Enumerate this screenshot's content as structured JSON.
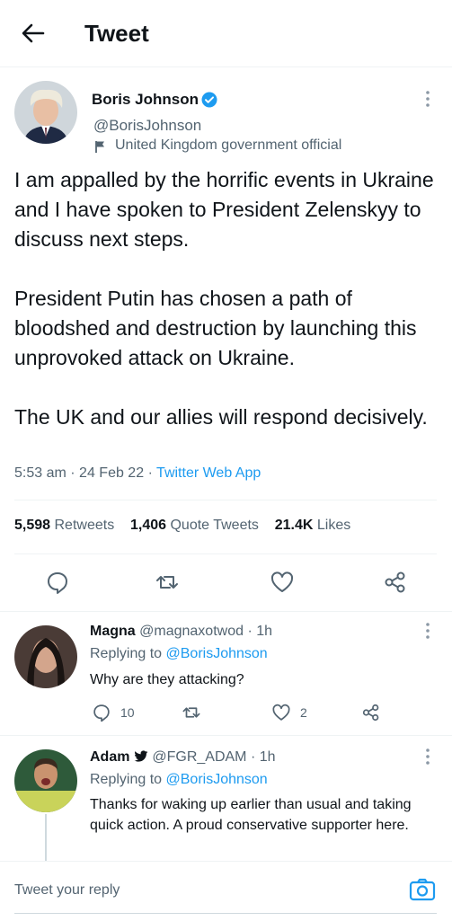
{
  "header": {
    "title": "Tweet"
  },
  "main_tweet": {
    "name": "Boris Johnson",
    "handle": "@BorisJohnson",
    "label": "United Kingdom government official",
    "text": "I am appalled by the horrific events in Ukraine and I have spoken to President Zelenskyy to discuss next steps.\n\nPresident Putin has chosen a path of bloodshed and destruction by launching this unprovoked attack on Ukraine.\n\nThe UK and our allies will respond decisively.",
    "time": "5:53 am",
    "date": "24 Feb 22",
    "source": "Twitter Web App",
    "retweets_count": "5,598",
    "retweets_label": "Retweets",
    "quotes_count": "1,406",
    "quotes_label": "Quote Tweets",
    "likes_count": "21.4K",
    "likes_label": "Likes"
  },
  "replies": [
    {
      "name": "Magna",
      "handle": "@magnaxotwod",
      "age": "1h",
      "replying_prefix": "Replying to",
      "replying_to": "@BorisJohnson",
      "text": "Why are they attacking?",
      "reply_count": "10",
      "like_count": "2"
    },
    {
      "name": "Adam",
      "handle": "@FGR_ADAM",
      "age": "1h",
      "replying_prefix": "Replying to",
      "replying_to": "@BorisJohnson",
      "text": "Thanks for waking up earlier than usual and taking quick action. A proud conservative supporter here."
    }
  ],
  "composer": {
    "placeholder": "Tweet your reply"
  },
  "colors": {
    "accent": "#1d9bf0",
    "text": "#0f1419",
    "muted": "#536471",
    "divider": "#eff3f4"
  },
  "icons": [
    "back-arrow-icon",
    "verified-badge-icon",
    "flag-icon",
    "more-icon",
    "reply-icon",
    "retweet-icon",
    "like-icon",
    "share-icon",
    "twitter-bird-icon",
    "camera-icon"
  ]
}
